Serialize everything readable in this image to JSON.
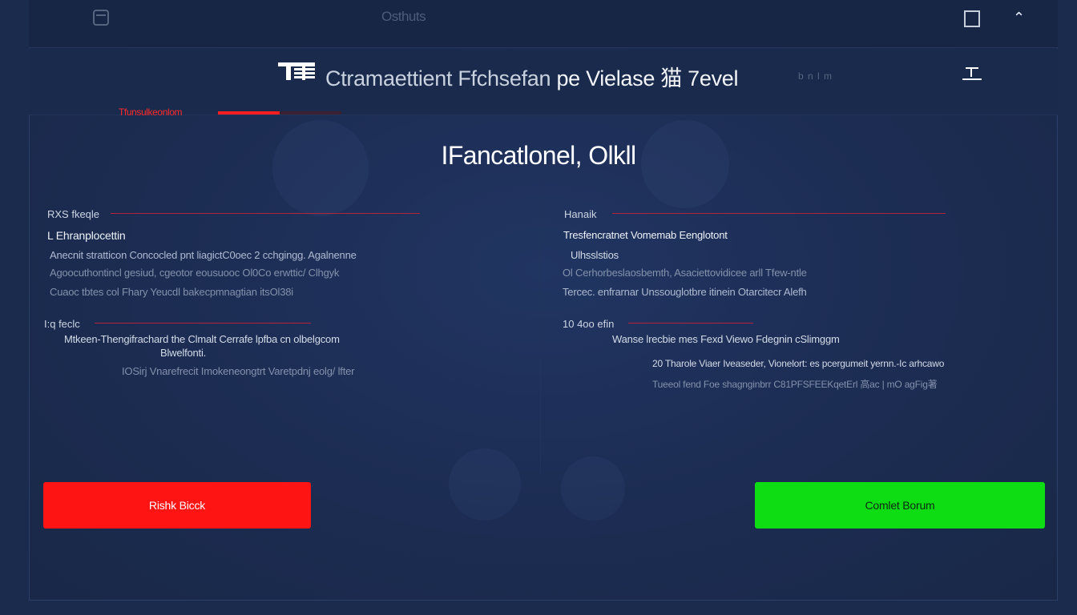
{
  "topbar": {
    "tab_label": "Osthuts"
  },
  "header": {
    "title_main": "Ctramaettient Ffchsefan",
    "title_part2": "pe Vielase",
    "title_glyph": "猫",
    "title_part3": "7evel",
    "meta": "b n l m"
  },
  "progress": {
    "label": "Tfunsulkeonlom",
    "value_fraction": 0.5,
    "color": "#ff1e1e"
  },
  "main": {
    "title": "IFancatlonel, Olkll"
  },
  "left_column": {
    "section1": {
      "heading": "RXS fkeqle",
      "lines": [
        "L Ehranplocettin",
        "Anecnit stratticon Concocled pnt liagictC0oec 2 cchgingg. Agalnenne",
        "Agoocuthontincl gesiud, cgeotor eousuooc Ol0Co erwttic/ Clhgyk",
        "Cuaoc tbtes col Fhary Yeucdl bakecpmnagtian itsOl38i"
      ]
    },
    "section2": {
      "heading": "I:q feclc",
      "lines": [
        "Mtkeen-Thengifrachard the Clmalt Cerrafe lpfba cn olbelgcom",
        "Blwelfonti.",
        "IOSirj Vnarefrecit Imokeneongtrt Varetpdnj eolg/ lfter"
      ]
    }
  },
  "right_column": {
    "section1": {
      "heading": "Hanaik",
      "lines": [
        "Tresfencratnet Vomemab Eenglotont",
        "Ulhsslstios",
        "Ol Cerhorbeslaosbemth, Asaciettovidicee arll Tfew-ntle",
        "Tercec. enfrarnar Unssouglotbre itinein Otarcitecr Alefh"
      ]
    },
    "section2": {
      "heading": "10 4oo efin",
      "lines": [
        "Wanse lrecbie mes Fexd Viewo Fdegnin cSlimggm",
        "20 Tharole Viaer Iveaseder, Vionelort: es pcergumeit yernn.-Ic arhcawo",
        "Tueeol fend Foe shagnginbrr C81PFSFEEKqetErl 高ac | mO agFig著"
      ]
    }
  },
  "buttons": {
    "reject_label": "Rishk Bicck",
    "confirm_label": "Comlet Borum"
  },
  "colors": {
    "background": "#1b2b4e",
    "reject": "#ff1414",
    "confirm": "#0fdd14",
    "accent_rule": "#b4233a"
  }
}
